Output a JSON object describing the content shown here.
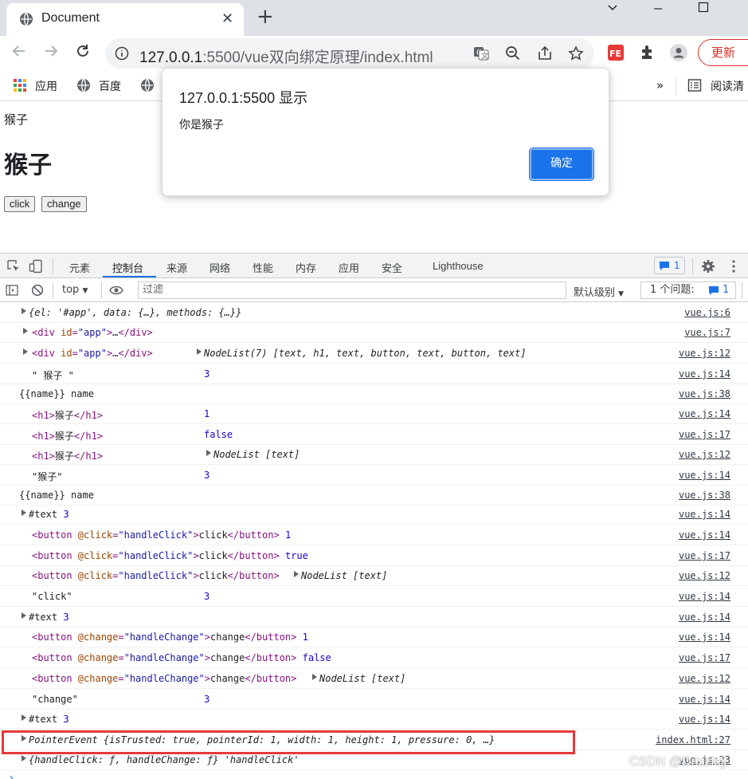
{
  "browser": {
    "tab_title": "Document",
    "url_host": "127.0.0.1",
    "url_rest": ":5500/vue双向绑定原理/index.html",
    "update_label": "更新",
    "bookmarks": [
      "应用",
      "百度"
    ],
    "reading_list": "阅读清"
  },
  "page": {
    "text": "猴子",
    "heading": "猴子",
    "click_button": "click",
    "change_button": "change"
  },
  "alert": {
    "title": "127.0.0.1:5500 显示",
    "message": "你是猴子",
    "ok_label": "确定"
  },
  "devtools": {
    "tabs": [
      "元素",
      "控制台",
      "来源",
      "网络",
      "性能",
      "内存",
      "应用",
      "安全",
      "Lighthouse"
    ],
    "active_tab": "控制台",
    "message_badge": "1",
    "context": "top",
    "filter_placeholder": "过滤",
    "level_label": "默认级别",
    "issues_label": "1 个问题:",
    "issues_count": "1"
  },
  "console": {
    "rows": [
      {
        "src": "vue.js:6"
      },
      {
        "src": "vue.js:7"
      },
      {
        "src": "vue.js:12"
      },
      {
        "src": "vue.js:14"
      },
      {
        "src": "vue.js:38"
      },
      {
        "src": "vue.js:14"
      },
      {
        "src": "vue.js:17"
      },
      {
        "src": "vue.js:12"
      },
      {
        "src": "vue.js:14"
      },
      {
        "src": "vue.js:38"
      },
      {
        "src": "vue.js:14"
      },
      {
        "src": "vue.js:14"
      },
      {
        "src": "vue.js:17"
      },
      {
        "src": "vue.js:12"
      },
      {
        "src": "vue.js:14"
      },
      {
        "src": "vue.js:14"
      },
      {
        "src": "vue.js:14"
      },
      {
        "src": "vue.js:17"
      },
      {
        "src": "vue.js:12"
      },
      {
        "src": "vue.js:14"
      },
      {
        "src": "vue.js:14"
      },
      {
        "src": "index.html:27"
      },
      {
        "src": "vue.js:23"
      }
    ],
    "num_3": "3",
    "num_1": "1",
    "val_false": "false",
    "val_true": "true",
    "name_text": "\" 猴子 \"",
    "name_text2": "\"猴子\"",
    "click_str": "\"click\"",
    "change_str": "\"change\"",
    "template_name": "{{name}} name",
    "text_node": "#text",
    "nodelist_text": "NodeList [text]",
    "nodelist7": "NodeList(7) [text, h1, text, button, text, button, text]",
    "pointer_event": "PointerEvent {isTrusted: true, pointerId: 1, width: 1, height: 1, pressure: 0, …}",
    "methods_obj": "{handleClick: ƒ, handleChange: ƒ} 'handleClick'",
    "vm_obj": "{el: '#app', data: {…}, methods: {…}}"
  },
  "watermark": "CSDN @Drizzlejj"
}
